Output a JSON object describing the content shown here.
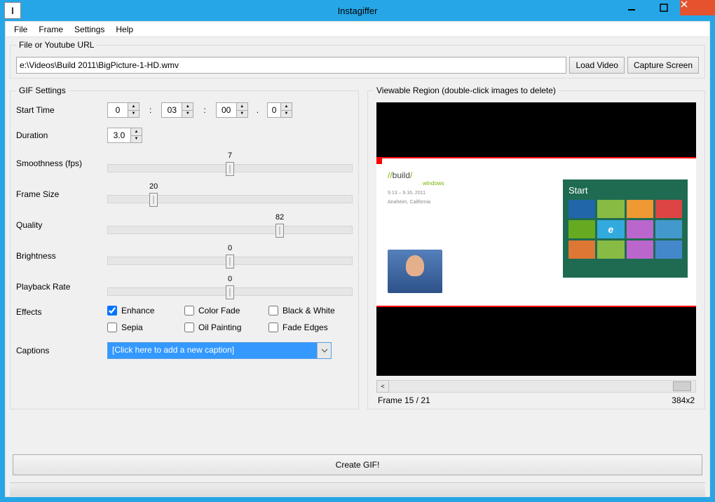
{
  "window": {
    "title": "Instagiffer",
    "icon_letter": "I"
  },
  "menu": {
    "file": "File",
    "frame": "Frame",
    "settings": "Settings",
    "help": "Help"
  },
  "url_section": {
    "legend": "File or Youtube URL",
    "path": "e:\\Videos\\Build 2011\\BigPicture-1-HD.wmv",
    "load_video": "Load Video",
    "capture_screen": "Capture Screen"
  },
  "gif": {
    "legend": "GIF Settings",
    "start_time_label": "Start Time",
    "start_hh": "0",
    "start_mm": "03",
    "start_ss": "00",
    "start_ff": "0",
    "duration_label": "Duration",
    "duration_val": "3.0",
    "smoothness_label": "Smoothness (fps)",
    "smoothness_val": "7",
    "frame_size_label": "Frame Size",
    "frame_size_val": "20",
    "quality_label": "Quality",
    "quality_val": "82",
    "brightness_label": "Brightness",
    "brightness_val": "0",
    "playback_label": "Playback Rate",
    "playback_val": "0",
    "effects_label": "Effects",
    "effects": {
      "enhance": "Enhance",
      "color_fade": "Color Fade",
      "bw": "Black & White",
      "sepia": "Sepia",
      "oil": "Oil Painting",
      "fade": "Fade Edges"
    },
    "captions_label": "Captions",
    "captions_placeholder": "[Click here to add a new caption]"
  },
  "viewer": {
    "legend": "Viewable Region (double-click images to delete)",
    "slide_title_a": "//",
    "slide_title_b": "build",
    "slide_title_c": "/",
    "slide_sub": "windows",
    "slide_meta1": "9.13 – 9.16, 2011",
    "slide_meta2": "Anaheim, California",
    "start_label": "Start",
    "nav_prev": "<",
    "frame_counter": "Frame  15 / 21",
    "dimensions": "384x2"
  },
  "create_label": "Create GIF!"
}
